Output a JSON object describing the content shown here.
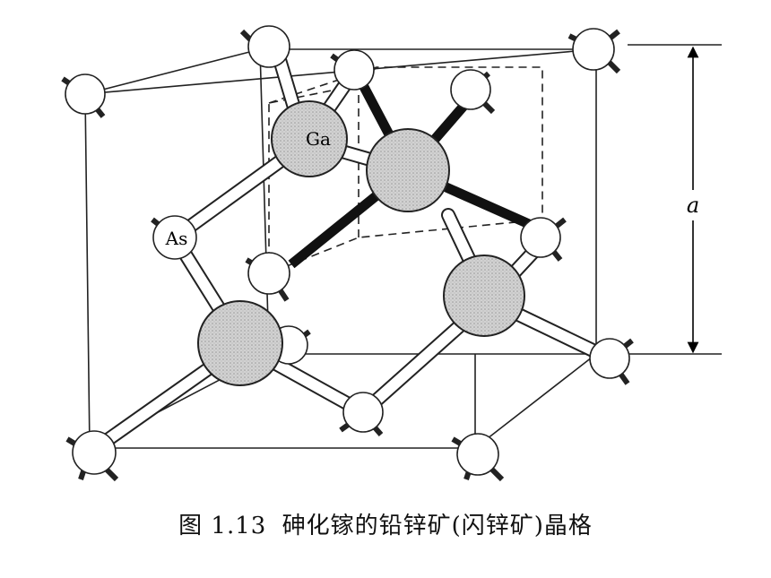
{
  "figure": {
    "caption_number": "图 1.13",
    "caption_text": "砷化镓的铅锌矿(闪锌矿)晶格"
  },
  "labels": {
    "ga": "Ga",
    "as": "As",
    "lattice_constant": "a"
  }
}
